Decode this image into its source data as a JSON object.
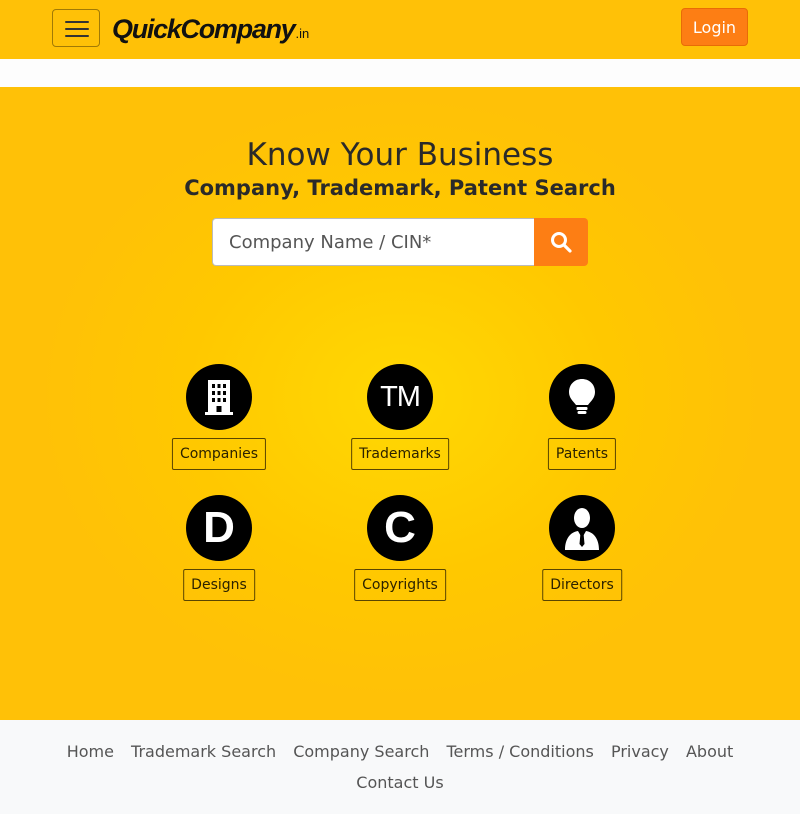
{
  "header": {
    "logo_main": "QuickCompany",
    "logo_sub": ".in",
    "login_label": "Login",
    "menu_icon": "hamburger-icon"
  },
  "hero": {
    "title": "Know Your Business",
    "subtitle": "Company, Trademark, Patent Search",
    "search": {
      "placeholder": "Company Name / CIN*",
      "value": "",
      "button_icon": "search-icon"
    }
  },
  "categories": [
    {
      "label": "Companies",
      "icon": "building-icon"
    },
    {
      "label": "Trademarks",
      "icon": "tm-icon",
      "glyph": "TM"
    },
    {
      "label": "Patents",
      "icon": "lightbulb-icon"
    },
    {
      "label": "Designs",
      "icon": "designs-icon",
      "glyph": "D"
    },
    {
      "label": "Copyrights",
      "icon": "copyright-icon",
      "glyph": "C"
    },
    {
      "label": "Directors",
      "icon": "director-icon"
    }
  ],
  "footer": {
    "links": [
      "Home",
      "Trademark Search",
      "Company Search",
      "Terms / Conditions",
      "Privacy",
      "About"
    ],
    "links_row2": [
      "Contact Us"
    ]
  },
  "colors": {
    "brand_yellow": "#ffc107",
    "accent_orange": "#fd7e14",
    "footer_bg": "#f8f9fa"
  }
}
